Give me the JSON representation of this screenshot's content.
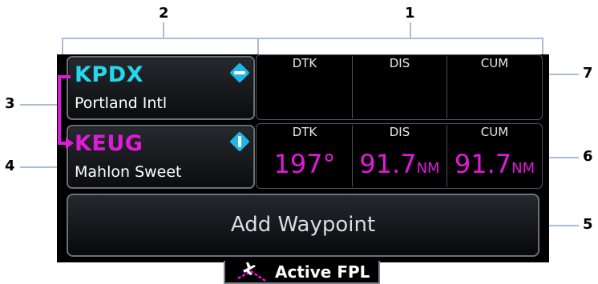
{
  "callouts": {
    "c1": "1",
    "c2": "2",
    "c3": "3",
    "c4": "4",
    "c5": "5",
    "c6": "6",
    "c7": "7"
  },
  "flight_plan": {
    "waypoints": [
      {
        "ident": "KPDX",
        "name": "Portland Intl",
        "ident_color": "#23d8ee",
        "dtk_header": "DTK",
        "dis_header": "DIS",
        "cum_header": "CUM",
        "dtk": "",
        "dis": "",
        "cum": ""
      },
      {
        "ident": "KEUG",
        "name": "Mahlon Sweet",
        "ident_color": "#e01ad9",
        "dtk_header": "DTK",
        "dis_header": "DIS",
        "cum_header": "CUM",
        "dtk": "197°",
        "dis": "91.7",
        "dis_unit": "NM",
        "cum": "91.7",
        "cum_unit": "NM"
      }
    ],
    "add_waypoint_label": "Add Waypoint",
    "active_leg_color": "#e01ad9"
  },
  "tab": {
    "label": "Active FPL",
    "icon": "airplane-route-icon"
  }
}
